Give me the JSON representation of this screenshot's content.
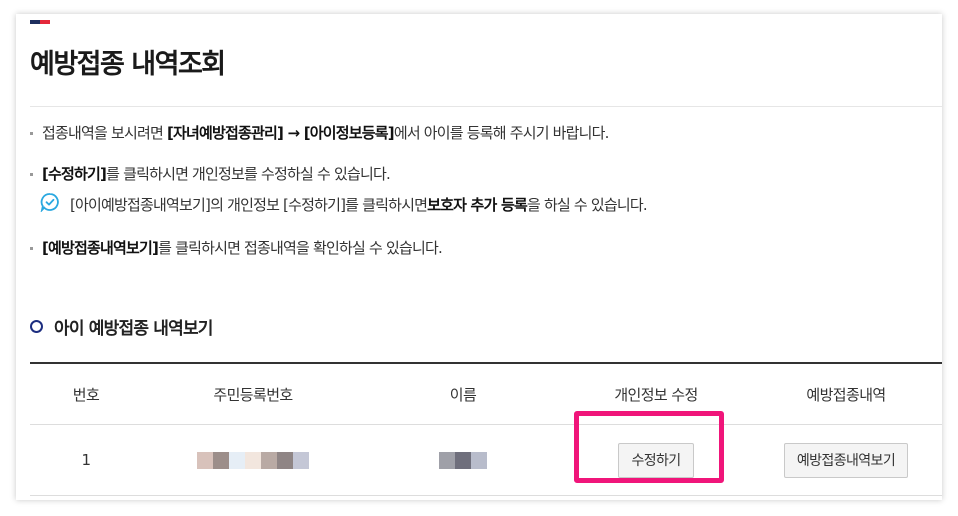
{
  "header": {
    "title": "예방접종 내역조회",
    "accent_colors": [
      "#1d2e5e",
      "#e4283a"
    ]
  },
  "info": {
    "line1": {
      "pre": "접종내역을 보시려면 ",
      "bold1": "[자녀예방접종관리]",
      "mid1": " → ",
      "bold2": "[아이정보등록]",
      "post": "에서 아이를 등록해 주시기 바랍니다."
    },
    "line2": {
      "bold": "[수정하기]",
      "post": "를 클릭하시면 개인정보를 수정하실 수 있습니다."
    },
    "note": {
      "icon": "speech-bubble-check-icon",
      "pre": "[아이예방접종내역보기]의 개인정보 [수정하기]를 클릭하시면 ",
      "bold": "보호자 추가 등록",
      "post": "을 하실 수 있습니다."
    },
    "line3": {
      "bold": "[예방접종내역보기]",
      "post": "를 클릭하시면 접종내역을 확인하실 수 있습니다."
    }
  },
  "section": {
    "title": "아이 예방접종 내역보기"
  },
  "table": {
    "headers": [
      "번호",
      "주민등록번호",
      "이름",
      "개인정보 수정",
      "예방접종내역"
    ],
    "rows": [
      {
        "number": "1",
        "edit_label": "수정하기",
        "history_label": "예방접종내역보기"
      }
    ]
  },
  "highlight_color": "#f0157a"
}
